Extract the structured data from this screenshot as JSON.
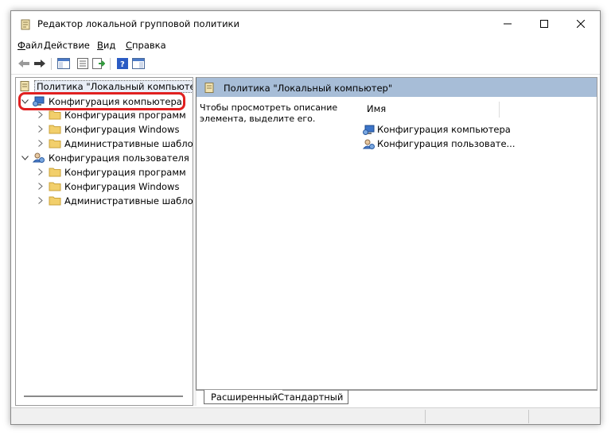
{
  "window": {
    "title": "Редактор локальной групповой политики",
    "icons": {
      "app": "policy-editor-icon",
      "minimize": "minimize-icon",
      "maximize": "maximize-icon",
      "close": "close-icon"
    }
  },
  "menu": {
    "items": [
      {
        "accel": "Ф",
        "rest": "айл"
      },
      {
        "accel": "Д",
        "rest": "ействие"
      },
      {
        "accel": "В",
        "rest": "ид"
      },
      {
        "accel": "С",
        "rest": "правка"
      }
    ]
  },
  "toolbar": {
    "buttons": [
      "back-arrow-icon",
      "forward-arrow-icon",
      "show-hide-tree-icon",
      "properties-icon",
      "export-list-icon",
      "help-icon",
      "show-hide-action-pane-icon"
    ]
  },
  "tree": {
    "root": "Политика \"Локальный компьютер\"",
    "items": [
      {
        "label": "Конфигурация компьютера",
        "icon": "computer-config-icon",
        "expanded": true
      },
      {
        "label": "Конфигурация программ",
        "icon": "folder-icon"
      },
      {
        "label": "Конфигурация Windows",
        "icon": "folder-icon"
      },
      {
        "label": "Административные шаблоны",
        "icon": "folder-icon"
      },
      {
        "label": "Конфигурация пользователя",
        "icon": "user-config-icon",
        "expanded": true
      },
      {
        "label": "Конфигурация программ",
        "icon": "folder-icon"
      },
      {
        "label": "Конфигурация Windows",
        "icon": "folder-icon"
      },
      {
        "label": "Административные шаблоны",
        "icon": "folder-icon"
      }
    ]
  },
  "details": {
    "header": "Политика \"Локальный компьютер\"",
    "description": "Чтобы просмотреть описание элемента, выделите его.",
    "column_name": "Имя",
    "rows": [
      {
        "label": "Конфигурация компьютера",
        "icon": "computer-config-icon"
      },
      {
        "label": "Конфигурация пользовате...",
        "icon": "user-config-icon"
      }
    ]
  },
  "tabs": {
    "extended": "Расширенный",
    "standard": "Стандартный"
  },
  "colors": {
    "header_band": "#a7bdd7",
    "highlight_ring": "#e02020",
    "folder": "#f2cf6b"
  }
}
